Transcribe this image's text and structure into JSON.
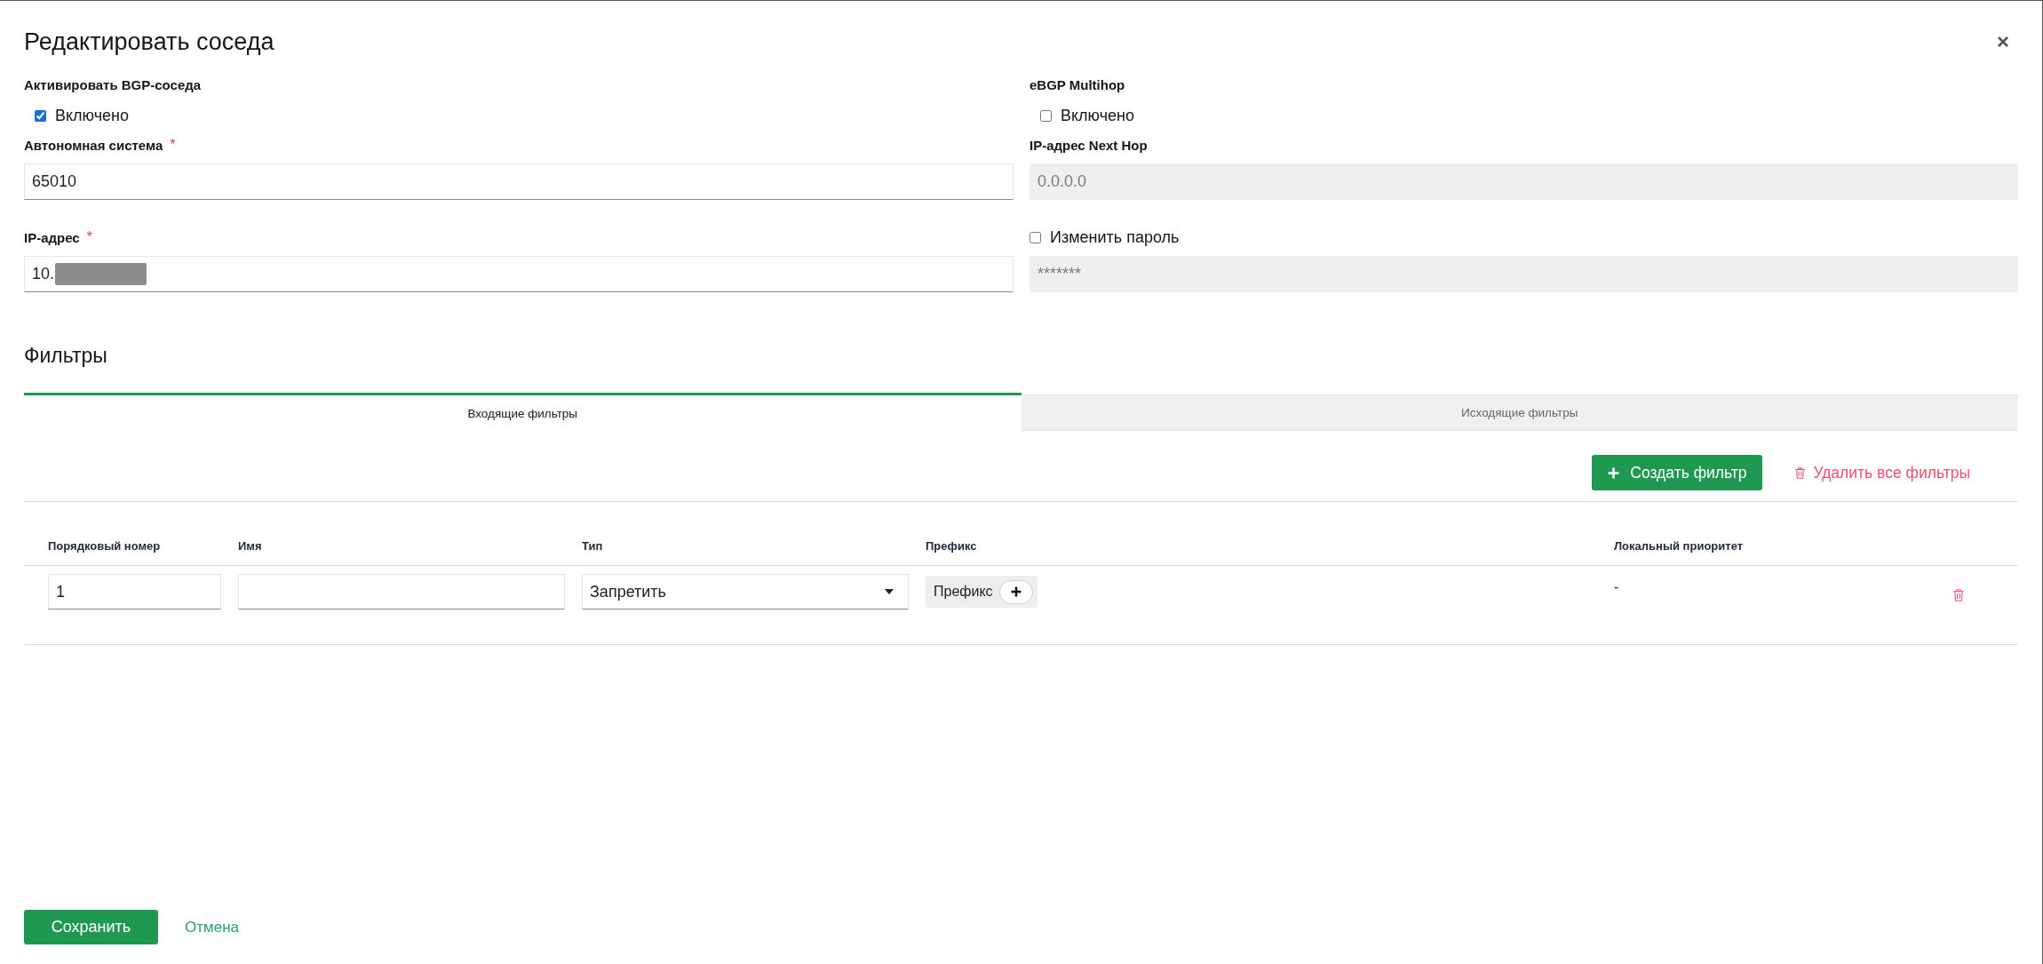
{
  "dialog": {
    "title": "Редактировать соседа"
  },
  "form": {
    "columns": [
      [
        {
          "kind": "checkbox",
          "label": "Активировать BGP-соседа",
          "option": "Включено",
          "checked": true
        },
        {
          "kind": "input",
          "label": "Автономная система",
          "required_mark": "*",
          "value": "65010",
          "disabled": false,
          "redacted": false
        },
        {
          "kind": "input",
          "label": "IP-адрес",
          "required_mark": "*",
          "value": "10.",
          "disabled": false,
          "redacted": true
        }
      ],
      [
        {
          "kind": "checkbox",
          "label": "eBGP Multihop",
          "option": "Включено",
          "checked": false
        },
        {
          "kind": "input",
          "label": "IP-адрес Next Hop",
          "placeholder": "0.0.0.0",
          "disabled": true,
          "redacted": false
        },
        {
          "kind": "checkbox_input",
          "option": "Изменить пароль",
          "checked": false,
          "placeholder": "*******",
          "disabled": true,
          "redacted": false
        }
      ]
    ]
  },
  "filters": {
    "title": "Фильтры",
    "tabs": [
      {
        "label": "Входящие фильтры",
        "selected": true
      },
      {
        "label": "Исходящие фильтры",
        "selected": false
      }
    ],
    "create_button": "Создать фильтр",
    "delete_all_button": "Удалить все фильтры",
    "table": {
      "columns": [
        "Порядковый номер",
        "Имя",
        "Тип",
        "Префикс",
        "Локальный приоритет"
      ],
      "rows": [
        {
          "order": "1",
          "type": "Запретить",
          "prefix": "Префикс",
          "local_priority": "-"
        }
      ]
    }
  },
  "footer": {
    "save": "Сохранить",
    "cancel": "Отмена"
  }
}
